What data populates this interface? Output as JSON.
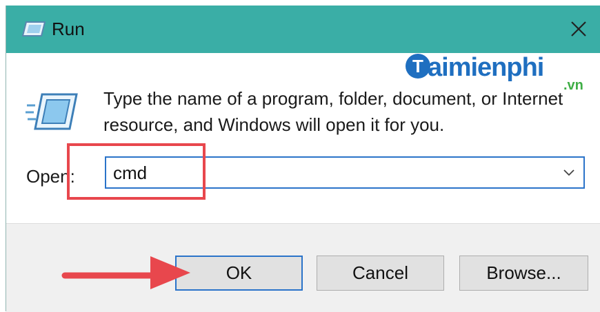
{
  "window": {
    "title": "Run",
    "title_icon": "run-icon",
    "close_icon": "close-icon"
  },
  "dialog": {
    "description_line1": "Type the name of a program, folder, document, or Internet",
    "description_line2": "resource, and Windows will open it for you.",
    "open_label": "Open:",
    "open_value": "cmd",
    "dropdown_icon": "chevron-down-icon"
  },
  "buttons": {
    "ok": "OK",
    "cancel": "Cancel",
    "browse": "Browse..."
  },
  "watermark": {
    "brand": "aimienphi",
    "brand_initial": "T",
    "brand_ext": ".vn"
  },
  "colors": {
    "titlebar": "#3aaea6",
    "accent": "#2a73c9",
    "annotation": "#e8474d"
  }
}
